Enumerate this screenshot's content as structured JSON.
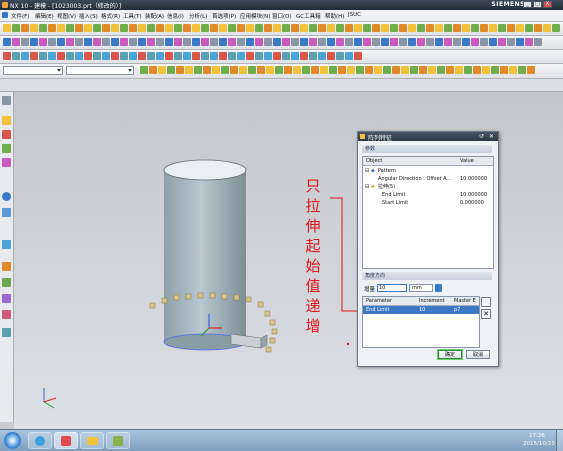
{
  "window": {
    "title": "NX 10 - 建模 - [1023003.prt（修改的）]",
    "brand": "SIEMENS",
    "min": "_",
    "max": "□",
    "close": "X"
  },
  "menu": {
    "items": [
      "文件(F)",
      "编辑(E)",
      "视图(V)",
      "插入(S)",
      "格式(R)",
      "工具(T)",
      "装配(A)",
      "信息(I)",
      "分析(L)",
      "首选项(P)",
      "应用模块(N)",
      "窗口(O)",
      "GC工具箱",
      "帮助(H)",
      "JSUC"
    ]
  },
  "annotation": {
    "text": [
      "只",
      "拉",
      "伸",
      "起",
      "始",
      "值",
      "递",
      "增"
    ],
    "color": "#e0141a"
  },
  "dialog": {
    "title": "阵列特征",
    "section_params": "参数",
    "tree_headers": {
      "object": "Object",
      "value": "Value"
    },
    "tree_rows": [
      {
        "object": "Pattern",
        "value": ""
      },
      {
        "object": "Angular Direction : Offset A...",
        "value": "10.000000"
      },
      {
        "object": "拉伸(5)",
        "value": ""
      },
      {
        "object": "End Limit",
        "value": "10.000000"
      },
      {
        "object": "Start Limit",
        "value": "0.000000"
      }
    ],
    "section_dir": "角度方向",
    "incr_label": "增量",
    "incr_value": "10",
    "incr_unit": "mm",
    "table_headers": {
      "parameter": "Parameter",
      "increment": "Increment",
      "master": "Master E"
    },
    "table_row": {
      "parameter": "End Limit",
      "increment": "10",
      "master": "p7"
    },
    "ok": "确定",
    "cancel": "取消"
  },
  "taskbar": {
    "time": "17:26",
    "date": "2015/10/23"
  },
  "colors": {
    "accent": "#3a78c8",
    "cylinder": "#9eb1b8",
    "dialog_title": "#2c3644"
  }
}
